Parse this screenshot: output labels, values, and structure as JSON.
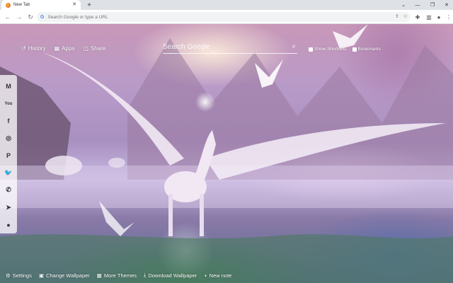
{
  "browser": {
    "tab_title": "New Tab",
    "tab_close": "✕",
    "new_tab": "+",
    "omnibox_placeholder": "Search Google or type a URL",
    "window_controls": [
      "⌄",
      "—",
      "❐",
      "✕"
    ]
  },
  "newtab": {
    "top_links": [
      {
        "icon": "history-icon",
        "glyph": "↺",
        "label": "History"
      },
      {
        "icon": "apps-icon",
        "glyph": "▦",
        "label": "Apps"
      },
      {
        "icon": "share-icon",
        "glyph": "◫",
        "label": "Share"
      }
    ],
    "search_placeholder": "Search Google",
    "right_links": [
      {
        "icon": "shortcuts-icon",
        "label": "Show Shortcuts"
      },
      {
        "icon": "bookmarks-icon",
        "label": "Bookmarks"
      }
    ],
    "social": [
      {
        "icon": "gmail-icon",
        "glyph": "M"
      },
      {
        "icon": "youtube-icon",
        "glyph": "You"
      },
      {
        "icon": "facebook-icon",
        "glyph": "f"
      },
      {
        "icon": "instagram-icon",
        "glyph": "◎"
      },
      {
        "icon": "pinterest-icon",
        "glyph": "P"
      },
      {
        "icon": "twitter-icon",
        "glyph": "🐦"
      },
      {
        "icon": "whatsapp-icon",
        "glyph": "✆"
      },
      {
        "icon": "telegram-icon",
        "glyph": "➤"
      },
      {
        "icon": "reddit-icon",
        "glyph": "●"
      }
    ],
    "bottom_links": [
      {
        "icon": "gear-icon",
        "glyph": "⚙",
        "label": "Settings"
      },
      {
        "icon": "wallpaper-icon",
        "glyph": "▣",
        "label": "Change Wallpaper"
      },
      {
        "icon": "themes-icon",
        "glyph": "▦",
        "label": "More Themes"
      },
      {
        "icon": "download-icon",
        "glyph": "⤓",
        "label": "Download Wallpaper"
      },
      {
        "icon": "plus-icon",
        "glyph": "+",
        "label": "New note"
      }
    ]
  }
}
